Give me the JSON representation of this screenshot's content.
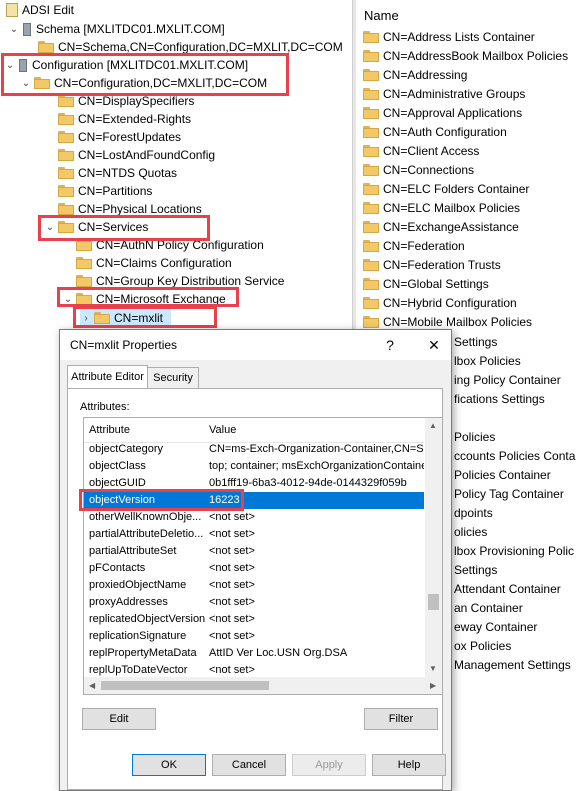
{
  "tree": {
    "root": "ADSI Edit",
    "items": [
      {
        "label": "Schema [MXLITDC01.MXLIT.COM]"
      },
      {
        "label": "CN=Schema,CN=Configuration,DC=MXLIT,DC=COM"
      },
      {
        "label": "Configuration [MXLITDC01.MXLIT.COM]"
      },
      {
        "label": "CN=Configuration,DC=MXLIT,DC=COM"
      },
      {
        "label": "CN=DisplaySpecifiers"
      },
      {
        "label": "CN=Extended-Rights"
      },
      {
        "label": "CN=ForestUpdates"
      },
      {
        "label": "CN=LostAndFoundConfig"
      },
      {
        "label": "CN=NTDS Quotas"
      },
      {
        "label": "CN=Partitions"
      },
      {
        "label": "CN=Physical Locations"
      },
      {
        "label": "CN=Services"
      },
      {
        "label": "CN=AuthN Policy Configuration"
      },
      {
        "label": "CN=Claims Configuration"
      },
      {
        "label": "CN=Group Key Distribution Service"
      },
      {
        "label": "CN=Microsoft Exchange"
      },
      {
        "label": "CN=mxlit"
      }
    ]
  },
  "list": {
    "header": "Name",
    "items": [
      "CN=Address Lists Container",
      "CN=AddressBook Mailbox Policies",
      "CN=Addressing",
      "CN=Administrative Groups",
      "CN=Approval Applications",
      "CN=Auth Configuration",
      "CN=Client Access",
      "CN=Connections",
      "CN=ELC Folders Container",
      "CN=ELC Mailbox Policies",
      "CN=ExchangeAssistance",
      "CN=Federation",
      "CN=Federation Trusts",
      "CN=Global Settings",
      "CN=Hybrid Configuration",
      "CN=Mobile Mailbox Policies"
    ],
    "partial_items": [
      "Settings",
      "lbox Policies",
      "ing Policy Container",
      "fications Settings",
      "",
      "Policies",
      "ccounts Policies Conta",
      "Policies Container",
      "Policy Tag Container",
      "dpoints",
      "olicies",
      "lbox Provisioning Polic",
      "Settings",
      "Attendant Container",
      "an Container",
      "eway Container",
      "ox Policies",
      "Management Settings"
    ]
  },
  "dialog": {
    "title": "CN=mxlit Properties",
    "help_label": "?",
    "close_label": "✕",
    "tabs": [
      "Attribute Editor",
      "Security"
    ],
    "attributes_label": "Attributes:",
    "columns": [
      "Attribute",
      "Value"
    ],
    "rows": [
      {
        "attr": "objectCategory",
        "value": "CN=ms-Exch-Organization-Container,CN=Sch"
      },
      {
        "attr": "objectClass",
        "value": "top; container; msExchOrganizationContainer"
      },
      {
        "attr": "objectGUID",
        "value": "0b1fff19-6ba3-4012-94de-0144329f059b"
      },
      {
        "attr": "objectVersion",
        "value": "16223"
      },
      {
        "attr": "otherWellKnownObje...",
        "value": "<not set>"
      },
      {
        "attr": "partialAttributeDeletio...",
        "value": "<not set>"
      },
      {
        "attr": "partialAttributeSet",
        "value": "<not set>"
      },
      {
        "attr": "pFContacts",
        "value": "<not set>"
      },
      {
        "attr": "proxiedObjectName",
        "value": "<not set>"
      },
      {
        "attr": "proxyAddresses",
        "value": "<not set>"
      },
      {
        "attr": "replicatedObjectVersion",
        "value": "<not set>"
      },
      {
        "attr": "replicationSignature",
        "value": "<not set>"
      },
      {
        "attr": "replPropertyMetaData",
        "value": "AttID  Ver    Loc.USN                Org.DSA"
      },
      {
        "attr": "replUpToDateVector",
        "value": "<not set>"
      }
    ],
    "edit_label": "Edit",
    "filter_label": "Filter",
    "ok_label": "OK",
    "cancel_label": "Cancel",
    "apply_label": "Apply",
    "help_btn_label": "Help"
  },
  "colors": {
    "highlight": "#e8404c",
    "selection": "#0078d7"
  }
}
